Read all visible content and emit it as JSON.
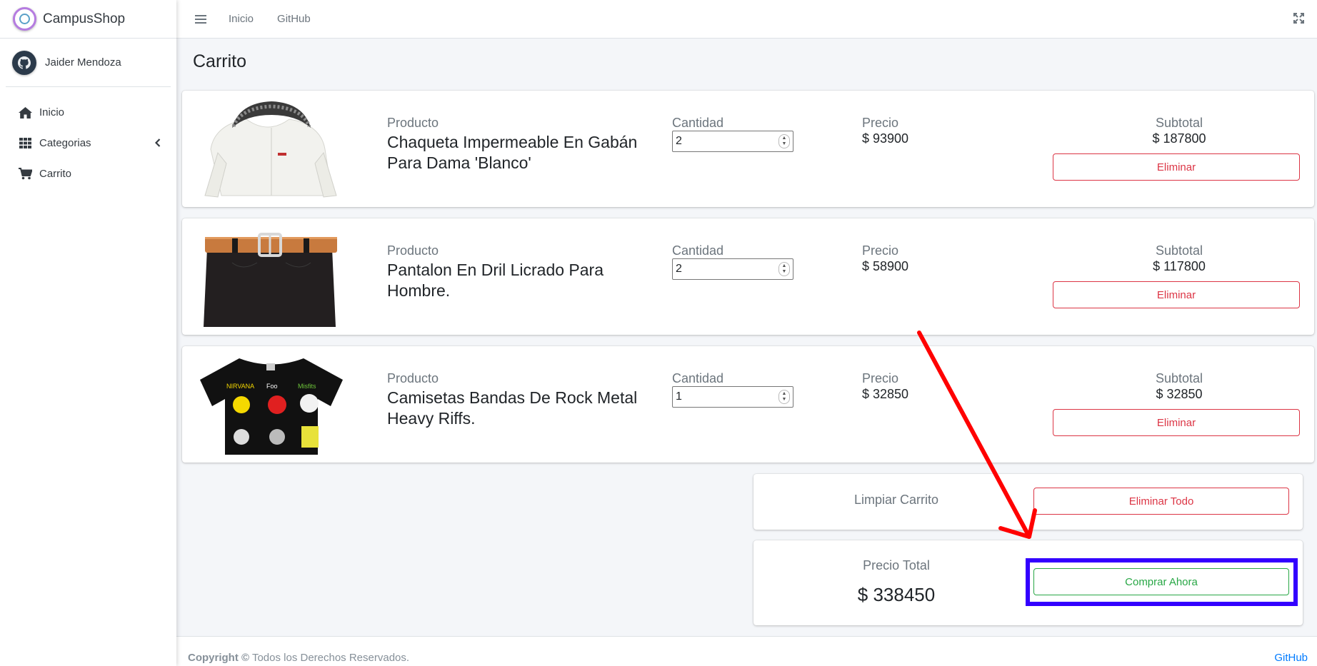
{
  "app": {
    "brand": "CampusShop",
    "user": "Jaider Mendoza"
  },
  "sidebar": {
    "items": [
      {
        "label": "Inicio",
        "icon": "home-icon"
      },
      {
        "label": "Categorias",
        "icon": "grid-icon"
      },
      {
        "label": "Carrito",
        "icon": "cart-icon"
      }
    ]
  },
  "topnav": {
    "links": [
      "Inicio",
      "GitHub"
    ]
  },
  "page": {
    "title": "Carrito"
  },
  "cart": {
    "labels": {
      "product": "Producto",
      "quantity": "Cantidad",
      "price": "Precio",
      "subtotal": "Subtotal",
      "delete": "Eliminar"
    },
    "items": [
      {
        "name": "Chaqueta Impermeable En Gabán Para Dama 'Blanco'",
        "quantity": "2",
        "price": "$ 93900",
        "subtotal": "$ 187800",
        "image": "white-hooded-jacket"
      },
      {
        "name": "Pantalon En Dril Licrado Para Hombre.",
        "quantity": "2",
        "price": "$ 58900",
        "subtotal": "$ 117800",
        "image": "black-pants-brown-belt"
      },
      {
        "name": "Camisetas Bandas De Rock Metal Heavy Riffs.",
        "quantity": "1",
        "price": "$ 32850",
        "subtotal": "$ 32850",
        "image": "black-band-tshirt"
      }
    ],
    "clear": {
      "label": "Limpiar Carrito",
      "button": "Eliminar Todo"
    },
    "total": {
      "label": "Precio Total",
      "value": "$ 338450",
      "button": "Comprar Ahora"
    }
  },
  "footer": {
    "copyright_bold": "Copyright ©",
    "copyright_rest": " Todos los Derechos Reservados.",
    "link": "GitHub"
  },
  "colors": {
    "danger": "#dc3545",
    "success": "#28a745",
    "highlight": "#3300ff",
    "annotation_arrow": "#ff0000",
    "link": "#007bff"
  }
}
